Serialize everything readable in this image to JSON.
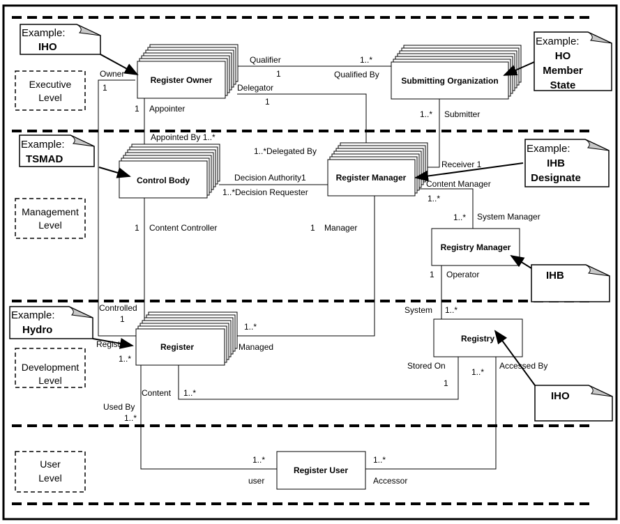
{
  "levels": {
    "executive": [
      "Executive",
      "Level"
    ],
    "management": [
      "Management",
      "Level"
    ],
    "development": [
      "Development",
      "Level"
    ],
    "user": [
      "User",
      "Level"
    ]
  },
  "classes": {
    "register_owner": "Register Owner",
    "submitting_organization": "Submitting Organization",
    "control_body": "Control Body",
    "register_manager": "Register Manager",
    "registry_manager": "Registry Manager",
    "register": "Register",
    "registry": "Registry",
    "register_user": "Register User"
  },
  "notes": {
    "iho_top": [
      "Example:",
      "IHO"
    ],
    "tsmad": [
      "Example:",
      "TSMAD"
    ],
    "ho_member_state": [
      "Example:",
      "HO",
      "Member",
      "State"
    ],
    "ihb_designate": [
      "Example:",
      "IHB",
      "Designate"
    ],
    "ihb": [
      "IHB"
    ],
    "hydro": [
      "Example:",
      "Hydro"
    ],
    "iho_bottom": [
      "IHO"
    ]
  },
  "roles": {
    "owner": "Owner",
    "owner_mult": "1",
    "appointer_mult": "1",
    "appointer": "Appointer",
    "appointed_by": "Appointed By 1..*",
    "qualifier": "Qualifier",
    "qualifier_mult": "1",
    "qualified_mult": "1..*",
    "qualified_by": "Qualified By",
    "delegator": "Delegator",
    "delegator_mult": "1",
    "delegated_by": "1..*Delegated By",
    "submitter_mult": "1..*",
    "submitter": "Submitter",
    "receiver": "Receiver 1",
    "decision_authority": "Decision Authority1",
    "decision_requester": "1..*Decision Requester",
    "content_manager": "Content Manager",
    "content_manager_mult": "1..*",
    "system_manager_mult": "1..*",
    "system_manager": "System Manager",
    "content_controller_mult": "1",
    "content_controller": "Content Controller",
    "manager_mult": "1",
    "manager": "Manager",
    "operator_mult": "1",
    "operator": "Operator",
    "system": "System",
    "system_mult": "1..*",
    "controlled": "Controlled",
    "controlled_mult": "1",
    "managed_mult": "1..*",
    "managed": "Managed",
    "register_role": "Register",
    "register_mult": "1..*",
    "content": "Content",
    "content_mult": "1..*",
    "stored_on": "Stored On",
    "stored_on_mult": "1",
    "accessed_by_mult": "1..*",
    "accessed_by": "Accessed By",
    "used_by": "Used By",
    "used_by_mult": "1..*",
    "user_mult": "1..*",
    "user": "user",
    "accessor_mult": "1..*",
    "accessor": "Accessor"
  }
}
